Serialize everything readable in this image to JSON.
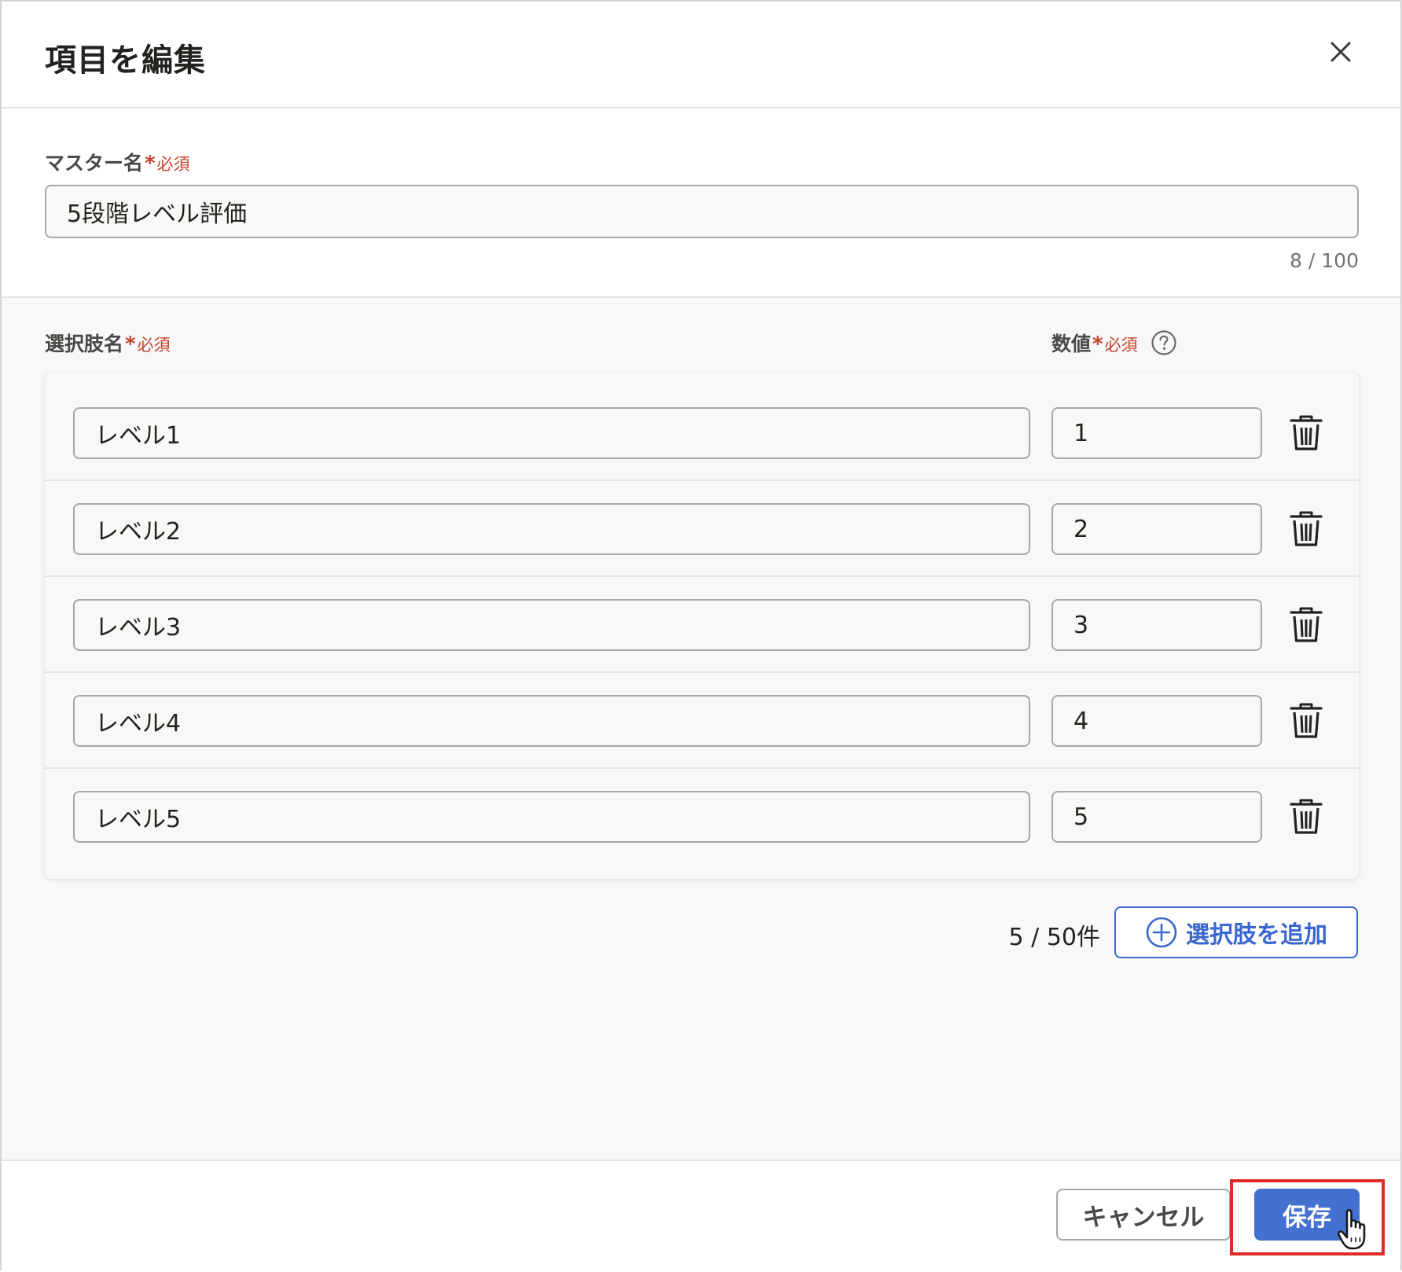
{
  "dialog": {
    "title": "項目を編集"
  },
  "master": {
    "label": "マスター名",
    "required_star": "*",
    "required_text": "必須",
    "value": "5段階レベル評価",
    "char_count": "8 / 100"
  },
  "options": {
    "name_label": "選択肢名",
    "value_label": "数値",
    "required_star": "*",
    "required_text": "必須",
    "rows": [
      {
        "name": "レベル1",
        "value": "1"
      },
      {
        "name": "レベル2",
        "value": "2"
      },
      {
        "name": "レベル3",
        "value": "3"
      },
      {
        "name": "レベル4",
        "value": "4"
      },
      {
        "name": "レベル5",
        "value": "5"
      }
    ],
    "count": "5 / 50件",
    "add_label": "選択肢を追加"
  },
  "footer": {
    "cancel_label": "キャンセル",
    "save_label": "保存"
  },
  "icons": {
    "close": "close-icon",
    "help": "help-circle-icon",
    "delete": "trash-icon",
    "add": "plus-circle-icon",
    "cursor": "hand-pointer-icon"
  },
  "colors": {
    "accent": "#4470d2",
    "required": "#c8412a",
    "highlight": "#e02a25"
  }
}
